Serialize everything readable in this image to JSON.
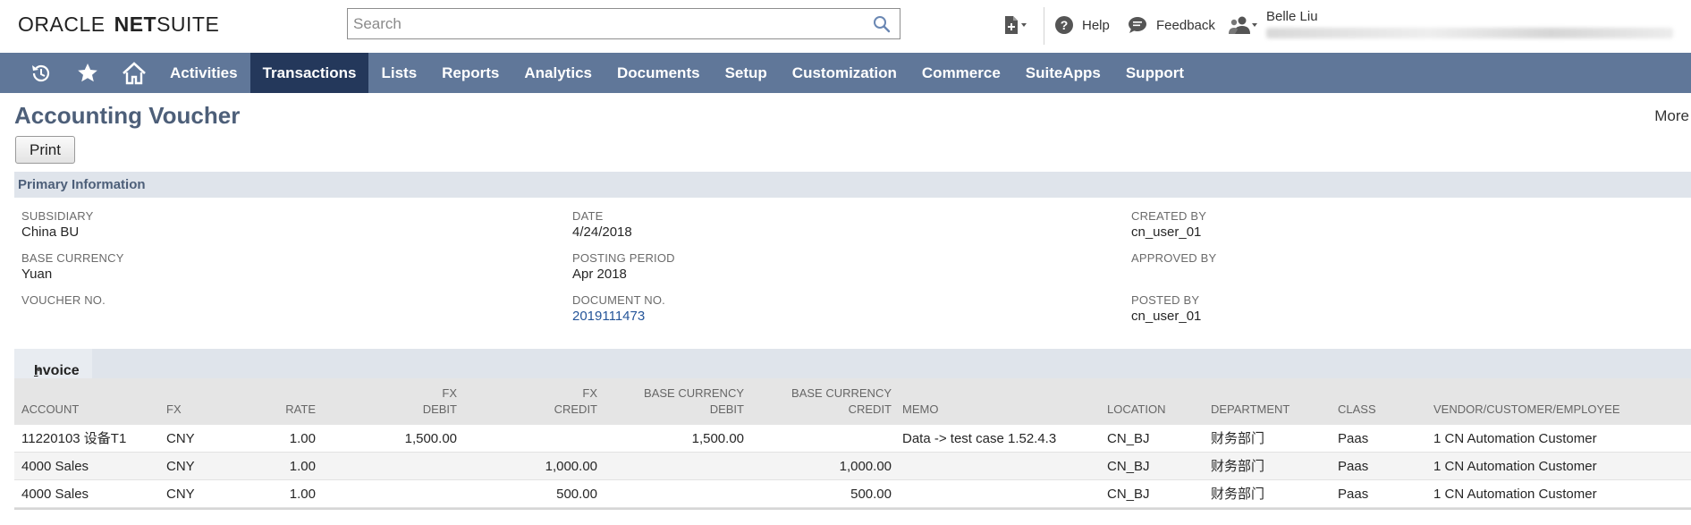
{
  "header": {
    "logo_oracle": "ORACLE",
    "logo_net": "NET",
    "logo_suite": "SUITE",
    "search_placeholder": "Search",
    "help_label": "Help",
    "feedback_label": "Feedback",
    "user_name": "Belle Liu"
  },
  "nav": {
    "items": [
      {
        "label": "Activities"
      },
      {
        "label": "Transactions"
      },
      {
        "label": "Lists"
      },
      {
        "label": "Reports"
      },
      {
        "label": "Analytics"
      },
      {
        "label": "Documents"
      },
      {
        "label": "Setup"
      },
      {
        "label": "Customization"
      },
      {
        "label": "Commerce"
      },
      {
        "label": "SuiteApps"
      },
      {
        "label": "Support"
      }
    ],
    "active": "Transactions"
  },
  "page": {
    "title": "Accounting Voucher",
    "more_label": "More",
    "print_label": "Print"
  },
  "primary": {
    "section_title": "Primary Information",
    "subsidiary_label": "SUBSIDIARY",
    "subsidiary_value": "China BU",
    "base_currency_label": "BASE CURRENCY",
    "base_currency_value": "Yuan",
    "voucher_no_label": "VOUCHER NO.",
    "date_label": "DATE",
    "date_value": "4/24/2018",
    "posting_period_label": "POSTING PERIOD",
    "posting_period_value": "Apr 2018",
    "document_no_label": "DOCUMENT NO.",
    "document_no_value": "2019111473",
    "created_by_label": "CREATED BY",
    "created_by_value": "cn_user_01",
    "approved_by_label": "APPROVED BY",
    "posted_by_label": "POSTED BY",
    "posted_by_value": "cn_user_01"
  },
  "invoice": {
    "tab_first_letter": "I",
    "tab_rest": "nvoice",
    "tab_marker": "•",
    "columns": {
      "account": "ACCOUNT",
      "fx": "FX",
      "rate": "RATE",
      "fx_debit_1": "FX",
      "fx_debit_2": "DEBIT",
      "fx_credit_1": "FX",
      "fx_credit_2": "CREDIT",
      "base_debit_1": "BASE CURRENCY",
      "base_debit_2": "DEBIT",
      "base_credit_1": "BASE CURRENCY",
      "base_credit_2": "CREDIT",
      "memo": "MEMO",
      "location": "LOCATION",
      "department": "DEPARTMENT",
      "class": "CLASS",
      "vendor": "VENDOR/CUSTOMER/EMPLOYEE"
    },
    "rows": [
      {
        "account": "11220103 设备T1",
        "fx": "CNY",
        "rate": "1.00",
        "fx_debit": "1,500.00",
        "fx_credit": "",
        "base_debit": "1,500.00",
        "base_credit": "",
        "memo": "Data -> test case 1.52.4.3",
        "location": "CN_BJ",
        "department": "财务部门",
        "class": "Paas",
        "vendor": "1 CN Automation Customer"
      },
      {
        "account": "4000 Sales",
        "fx": "CNY",
        "rate": "1.00",
        "fx_debit": "",
        "fx_credit": "1,000.00",
        "base_debit": "",
        "base_credit": "1,000.00",
        "memo": "",
        "location": "CN_BJ",
        "department": "财务部门",
        "class": "Paas",
        "vendor": "1 CN Automation Customer"
      },
      {
        "account": "4000 Sales",
        "fx": "CNY",
        "rate": "1.00",
        "fx_debit": "",
        "fx_credit": "500.00",
        "base_debit": "",
        "base_credit": "500.00",
        "memo": "",
        "location": "CN_BJ",
        "department": "财务部门",
        "class": "Paas",
        "vendor": "1 CN Automation Customer"
      }
    ]
  },
  "colors": {
    "nav_bg": "#607799",
    "nav_active": "#24385b",
    "title_color": "#4d5f79",
    "section_bg": "#dfe4eb",
    "link": "#255599"
  },
  "icons": {
    "search": "search-icon",
    "new_record": "new-record-icon",
    "help": "help-icon",
    "feedback": "feedback-icon",
    "role_switch": "role-switch-icon",
    "recent": "recent-records-icon",
    "shortcuts": "star-icon",
    "home": "home-icon"
  }
}
